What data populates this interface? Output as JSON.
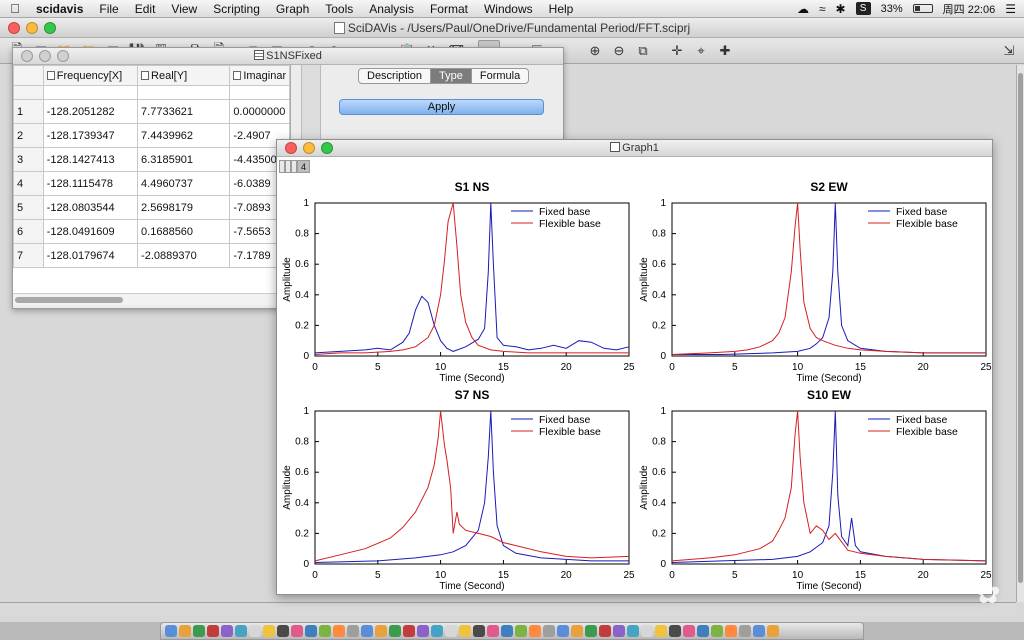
{
  "menubar": {
    "app_name": "scidavis",
    "items": [
      "File",
      "Edit",
      "View",
      "Scripting",
      "Graph",
      "Tools",
      "Analysis",
      "Format",
      "Windows",
      "Help"
    ],
    "s_label": "S",
    "battery": "33%",
    "battery_level": 0.33,
    "clock": "周四 22:06"
  },
  "main_window": {
    "title": "SciDAVis - /Users/Paul/OneDrive/Fundamental Period/FFT.sciprj"
  },
  "table_window": {
    "title": "S1NSFixed",
    "columns": [
      "Frequency[X]",
      "Real[Y]",
      "Imaginar"
    ],
    "rows": [
      {
        "n": "1",
        "freq": "-128.2051282",
        "real": "7.7733621",
        "imag": "0.0000000"
      },
      {
        "n": "2",
        "freq": "-128.1739347",
        "real": "7.4439962",
        "imag": "-2.4907"
      },
      {
        "n": "3",
        "freq": "-128.1427413",
        "real": "6.3185901",
        "imag": "-4.43500"
      },
      {
        "n": "4",
        "freq": "-128.1115478",
        "real": "4.4960737",
        "imag": "-6.0389"
      },
      {
        "n": "5",
        "freq": "-128.0803544",
        "real": "2.5698179",
        "imag": "-7.0893"
      },
      {
        "n": "6",
        "freq": "-128.0491609",
        "real": "0.1688560",
        "imag": "-7.5653"
      },
      {
        "n": "7",
        "freq": "-128.0179674",
        "real": "-2.0889370",
        "imag": "-7.1789"
      }
    ],
    "tabs": [
      "Description",
      "Type",
      "Formula"
    ],
    "selected_tab": "Type",
    "apply_label": "Apply"
  },
  "graph_window": {
    "title": "Graph1",
    "layer_buttons": [
      "1",
      "2",
      "3",
      "4"
    ],
    "current_layer": "4"
  },
  "chart_data": [
    {
      "type": "line",
      "title": "S1 NS",
      "xlabel": "Time (Second)",
      "ylabel": "Amplitude",
      "xlim": [
        0,
        25
      ],
      "ylim": [
        0,
        1
      ],
      "xticks": [
        0,
        5,
        10,
        15,
        20,
        25
      ],
      "yticks": [
        0,
        0.2,
        0.4,
        0.6,
        0.8,
        1
      ],
      "legend_position": "top-right",
      "series": [
        {
          "name": "Fixed base",
          "color": "#1a1ab8",
          "x": [
            0,
            2,
            4,
            5,
            6,
            7,
            7.5,
            8,
            8.5,
            9,
            9.5,
            10,
            10.5,
            11,
            12,
            13,
            13.5,
            13.8,
            14,
            14.2,
            14.5,
            15,
            16,
            17,
            18,
            19,
            20,
            21,
            22,
            23,
            24,
            25
          ],
          "y": [
            0.02,
            0.03,
            0.04,
            0.05,
            0.04,
            0.09,
            0.15,
            0.3,
            0.39,
            0.35,
            0.2,
            0.1,
            0.05,
            0.03,
            0.06,
            0.11,
            0.18,
            0.55,
            1.0,
            0.6,
            0.12,
            0.07,
            0.06,
            0.04,
            0.05,
            0.07,
            0.05,
            0.1,
            0.09,
            0.05,
            0.04,
            0.06
          ]
        },
        {
          "name": "Flexible base",
          "color": "#d42020",
          "x": [
            0,
            2,
            4,
            6,
            7,
            8,
            9,
            9.5,
            10,
            10.3,
            10.6,
            11,
            11.3,
            11.6,
            12,
            12.5,
            13,
            14,
            15,
            17,
            20,
            25
          ],
          "y": [
            0.01,
            0.02,
            0.02,
            0.03,
            0.04,
            0.06,
            0.12,
            0.2,
            0.4,
            0.62,
            0.88,
            1.0,
            0.72,
            0.4,
            0.22,
            0.12,
            0.07,
            0.04,
            0.03,
            0.02,
            0.02,
            0.02
          ]
        }
      ]
    },
    {
      "type": "line",
      "title": "S2 EW",
      "xlabel": "Time (Second)",
      "ylabel": "Amplitude",
      "xlim": [
        0,
        25
      ],
      "ylim": [
        0,
        1
      ],
      "xticks": [
        0,
        5,
        10,
        15,
        20,
        25
      ],
      "yticks": [
        0,
        0.2,
        0.4,
        0.6,
        0.8,
        1
      ],
      "legend_position": "top-right",
      "series": [
        {
          "name": "Fixed base",
          "color": "#1a1ab8",
          "x": [
            0,
            4,
            8,
            10,
            11,
            11.5,
            12,
            12.5,
            12.8,
            13,
            13.2,
            13.5,
            14,
            15,
            17,
            20,
            25
          ],
          "y": [
            0.01,
            0.01,
            0.02,
            0.03,
            0.05,
            0.08,
            0.12,
            0.25,
            0.55,
            1.0,
            0.55,
            0.2,
            0.1,
            0.05,
            0.03,
            0.02,
            0.02
          ]
        },
        {
          "name": "Flexible base",
          "color": "#d42020",
          "x": [
            0,
            3,
            5,
            6,
            7,
            8,
            8.5,
            9,
            9.5,
            9.8,
            10,
            10.2,
            10.5,
            11,
            11.5,
            12,
            13,
            14,
            15,
            17,
            20,
            25
          ],
          "y": [
            0.01,
            0.02,
            0.03,
            0.04,
            0.06,
            0.1,
            0.15,
            0.25,
            0.55,
            0.85,
            1.0,
            0.7,
            0.35,
            0.18,
            0.12,
            0.1,
            0.07,
            0.05,
            0.04,
            0.03,
            0.02,
            0.02
          ]
        }
      ]
    },
    {
      "type": "line",
      "title": "S7 NS",
      "xlabel": "Time (Second)",
      "ylabel": "Amplitude",
      "xlim": [
        0,
        25
      ],
      "ylim": [
        0,
        1
      ],
      "xticks": [
        0,
        5,
        10,
        15,
        20,
        25
      ],
      "yticks": [
        0,
        0.2,
        0.4,
        0.6,
        0.8,
        1
      ],
      "legend_position": "top-right",
      "series": [
        {
          "name": "Fixed base",
          "color": "#1a1ab8",
          "x": [
            0,
            5,
            8,
            10,
            11,
            12,
            13,
            13.5,
            13.8,
            14,
            14.2,
            14.5,
            15,
            16,
            18,
            20,
            22,
            25
          ],
          "y": [
            0.01,
            0.02,
            0.04,
            0.06,
            0.08,
            0.12,
            0.22,
            0.4,
            0.7,
            1.0,
            0.6,
            0.25,
            0.12,
            0.07,
            0.04,
            0.03,
            0.02,
            0.02
          ]
        },
        {
          "name": "Flexible base",
          "color": "#d42020",
          "x": [
            0,
            2,
            4,
            6,
            7,
            8,
            9,
            9.5,
            9.8,
            10,
            10.3,
            10.5,
            10.8,
            11,
            11.3,
            11.5,
            12,
            13,
            14,
            15,
            16,
            18,
            20,
            22,
            25
          ],
          "y": [
            0.02,
            0.06,
            0.1,
            0.17,
            0.24,
            0.34,
            0.5,
            0.65,
            0.82,
            1.0,
            0.78,
            0.68,
            0.5,
            0.2,
            0.34,
            0.26,
            0.22,
            0.2,
            0.18,
            0.14,
            0.12,
            0.08,
            0.05,
            0.04,
            0.05
          ]
        }
      ]
    },
    {
      "type": "line",
      "title": "S10 EW",
      "xlabel": "Time (Second)",
      "ylabel": "Amplitude",
      "xlim": [
        0,
        25
      ],
      "ylim": [
        0,
        1
      ],
      "xticks": [
        0,
        5,
        10,
        15,
        20,
        25
      ],
      "yticks": [
        0,
        0.2,
        0.4,
        0.6,
        0.8,
        1
      ],
      "legend_position": "top-right",
      "series": [
        {
          "name": "Fixed base",
          "color": "#1a1ab8",
          "x": [
            0,
            4,
            8,
            10,
            11,
            12,
            12.5,
            12.8,
            13,
            13.2,
            13.5,
            14,
            14.3,
            14.6,
            15,
            17,
            20,
            25
          ],
          "y": [
            0.01,
            0.02,
            0.03,
            0.05,
            0.08,
            0.14,
            0.25,
            0.6,
            1.0,
            0.45,
            0.18,
            0.12,
            0.3,
            0.12,
            0.08,
            0.05,
            0.03,
            0.02
          ]
        },
        {
          "name": "Flexible base",
          "color": "#d42020",
          "x": [
            0,
            3,
            5,
            7,
            8,
            8.5,
            9,
            9.5,
            9.8,
            10,
            10.2,
            10.5,
            11,
            11.5,
            12,
            12.5,
            13,
            14,
            15,
            17,
            20,
            25
          ],
          "y": [
            0.02,
            0.04,
            0.06,
            0.1,
            0.15,
            0.22,
            0.3,
            0.5,
            0.85,
            1.0,
            0.7,
            0.4,
            0.2,
            0.25,
            0.22,
            0.16,
            0.2,
            0.09,
            0.07,
            0.05,
            0.03,
            0.02
          ]
        }
      ]
    }
  ]
}
